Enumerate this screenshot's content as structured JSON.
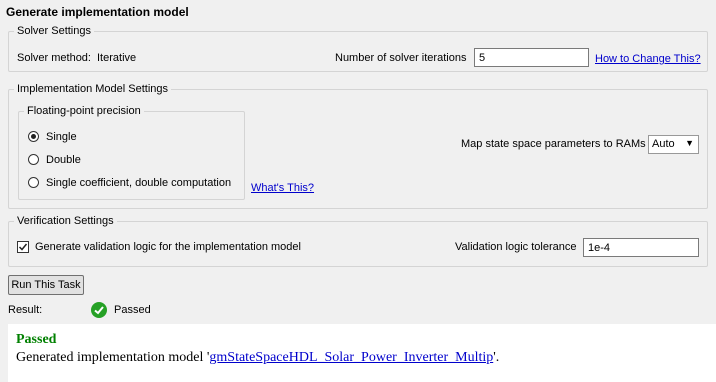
{
  "title": "Generate implementation model",
  "solver": {
    "legend": "Solver Settings",
    "method_label": "Solver method:",
    "method_value": "Iterative",
    "iterations_label": "Number of solver iterations",
    "iterations_value": "5",
    "how_link": "How to Change This?"
  },
  "impl": {
    "legend": "Implementation Model Settings",
    "precision_legend": "Floating-point precision",
    "options": [
      "Single",
      "Double",
      "Single coefficient, double computation"
    ],
    "selected": "Single",
    "whats_link": "What's This?",
    "map_label": "Map state space parameters to RAMs",
    "map_value": "Auto"
  },
  "verif": {
    "legend": "Verification Settings",
    "checkbox_label": "Generate validation logic for the implementation model",
    "checked": true,
    "tolerance_label": "Validation logic tolerance",
    "tolerance_value": "1e-4"
  },
  "run_button": "Run This Task",
  "result_label": "Result:",
  "result_value": "Passed",
  "output": {
    "status": "Passed",
    "msg_prefix": "Generated implementation model '",
    "model_link": "gmStateSpaceHDL_Solar_Power_Inverter_Multip",
    "msg_suffix": "'."
  },
  "colors": {
    "pass_green": "#26a126",
    "link_blue": "#0000cc",
    "status_green": "#008000"
  }
}
